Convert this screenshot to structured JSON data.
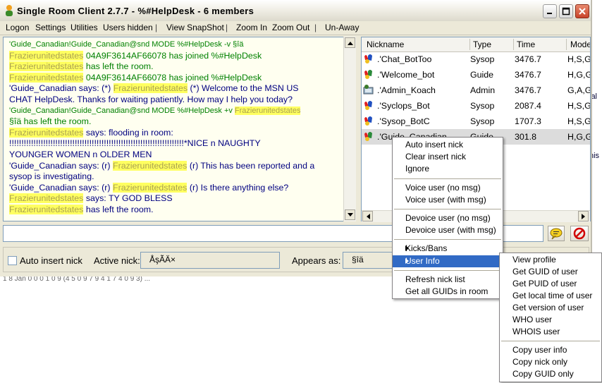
{
  "window": {
    "title": "Single Room Client 2.7.7 - %#HelpDesk - 6 members"
  },
  "menubar": {
    "items": [
      "Logon",
      "Settings",
      "Utilities",
      "Users hidden",
      "|",
      "View SnapShot",
      "|",
      "Zoom In",
      "Zoom Out",
      "|",
      "Un-Away"
    ]
  },
  "chat": {
    "lines": [
      {
        "text": "'Guide_Canadian!Guide_Canadian@snd MODE %#HelpDesk -v §îä",
        "color": "green",
        "size": "small"
      },
      {
        "pre": "",
        "hl": "Frazierunitedstates",
        "text": " 04A9F3614AF66078 has joined %#HelpDesk",
        "color": "green"
      },
      {
        "pre": "",
        "hl": "Frazierunitedstates",
        "text": " has left the room.",
        "color": "green"
      },
      {
        "pre": "",
        "hl": "Frazierunitedstates",
        "text": " 04A9F3614AF66078 has joined %#HelpDesk",
        "color": "green"
      },
      {
        "pre": "'Guide_Canadian says: (*) ",
        "hl": "Frazierunitedstates",
        "text": " (*) Welcome to the MSN US",
        "color": "navy"
      },
      {
        "pre": "CHAT HelpDesk. Thanks for waiting patiently. How may I help you today?",
        "hl": "",
        "text": "",
        "color": "navy"
      },
      {
        "pre": "'Guide_Canadian!Guide_Canadian@snd MODE %#HelpDesk +v ",
        "hl": "Frazierunitedstates",
        "text": "",
        "color": "green",
        "size": "small"
      },
      {
        "pre": "§îä has left the room.",
        "hl": "",
        "text": "",
        "color": "green"
      },
      {
        "pre": "",
        "hl": "Frazierunitedstates",
        "text": " says: flooding in room:",
        "color": "navy"
      },
      {
        "pre": "!!!!!!!!!!!!!!!!!!!!!!!!!!!!!!!!!!!!!!!!!!!!!!!!!!!!!!!!!!!!!!!!!!!!!!!!*NICE n NAUGHTY",
        "hl": "",
        "text": "",
        "color": "navy"
      },
      {
        "pre": "YOUNGER WOMEN n OLDER MEN",
        "hl": "",
        "text": "",
        "color": "navy"
      },
      {
        "pre": "'Guide_Canadian says: (r) ",
        "hl": "Frazierunitedstates",
        "text": " (r) This has been reported and a",
        "color": "navy"
      },
      {
        "pre": "sysop is investigating.",
        "hl": "",
        "text": "",
        "color": "navy"
      },
      {
        "pre": "'Guide_Canadian says: (r) ",
        "hl": "Frazierunitedstates",
        "text": " (r) Is there anything else?",
        "color": "navy"
      },
      {
        "pre": "",
        "hl": "Frazierunitedstates",
        "text": " says: TY GOD BLESS",
        "color": "navy"
      },
      {
        "pre": "",
        "hl": "Frazierunitedstates",
        "text": " has left the room.",
        "color": "navy"
      }
    ]
  },
  "nicklist": {
    "headers": [
      "Nickname",
      "Type",
      "Time",
      "Mode"
    ],
    "rows": [
      {
        "nick": ".'Chat_BotToo",
        "type": "Sysop",
        "time": "3476.7",
        "mode": "H,S,G",
        "icon": "sysop-icon"
      },
      {
        "nick": ".'Welcome_bot",
        "type": "Guide",
        "time": "3476.7",
        "mode": "H,G,G",
        "icon": "guide-icon"
      },
      {
        "nick": ".'Admin_Koach",
        "type": "Admin",
        "time": "3476.7",
        "mode": "G,A,G",
        "icon": "admin-icon"
      },
      {
        "nick": ".'Syclops_Bot",
        "type": "Sysop",
        "time": "2087.4",
        "mode": "H,S,G",
        "icon": "sysop-icon"
      },
      {
        "nick": ".'Sysop_BotC",
        "type": "Sysop",
        "time": "1707.3",
        "mode": "H,S,G",
        "icon": "sysop-icon"
      },
      {
        "nick": ".'Guide_Canadian",
        "type": "Guide",
        "time": "301.8",
        "mode": "H,G,G",
        "icon": "guide-icon"
      }
    ]
  },
  "bottom": {
    "auto_insert_label": "Auto insert nick",
    "active_nick_label": "Active nick:",
    "active_nick_value": "ÅşÃÄ×",
    "appears_as_label": "Appears as:",
    "appears_as_value": "§îä"
  },
  "context_menu": {
    "items": [
      {
        "label": "Auto insert nick"
      },
      {
        "label": "Clear insert nick"
      },
      {
        "label": "Ignore"
      },
      {
        "sep": true
      },
      {
        "label": "Voice user (no msg)"
      },
      {
        "label": "Voice user (with msg)"
      },
      {
        "sep": true
      },
      {
        "label": "Devoice user (no msg)"
      },
      {
        "label": "Devoice user (with msg)"
      },
      {
        "sep": true
      },
      {
        "label": "Kicks/Bans",
        "submenu": true
      },
      {
        "label": "User Info",
        "submenu": true,
        "hot": true
      },
      {
        "sep": true
      },
      {
        "label": "Refresh nick list"
      },
      {
        "label": "Get all GUIDs in room"
      }
    ]
  },
  "submenu": {
    "items": [
      {
        "label": "View profile"
      },
      {
        "label": "Get GUID of user"
      },
      {
        "label": "Get PUID of user"
      },
      {
        "label": "Get local time of user"
      },
      {
        "label": "Get version of user"
      },
      {
        "label": "WHO user"
      },
      {
        "label": "WHOIS user"
      },
      {
        "sep": true
      },
      {
        "label": "Copy user info"
      },
      {
        "label": "Copy nick only"
      },
      {
        "label": "Copy GUID only"
      }
    ]
  },
  "background": {
    "right_text": [
      "ial",
      "his"
    ],
    "strip_text": "1 8 Jan 0 0 0 1 0 9 (4 5 0 9 7 9 4 1 7 4 0 9 3) ..."
  },
  "colors": {
    "chat_bg": "#fffff0",
    "green_text": "#008000",
    "navy_text": "#000080",
    "highlight": "#ffff60",
    "menu_hot": "#316ac5"
  }
}
